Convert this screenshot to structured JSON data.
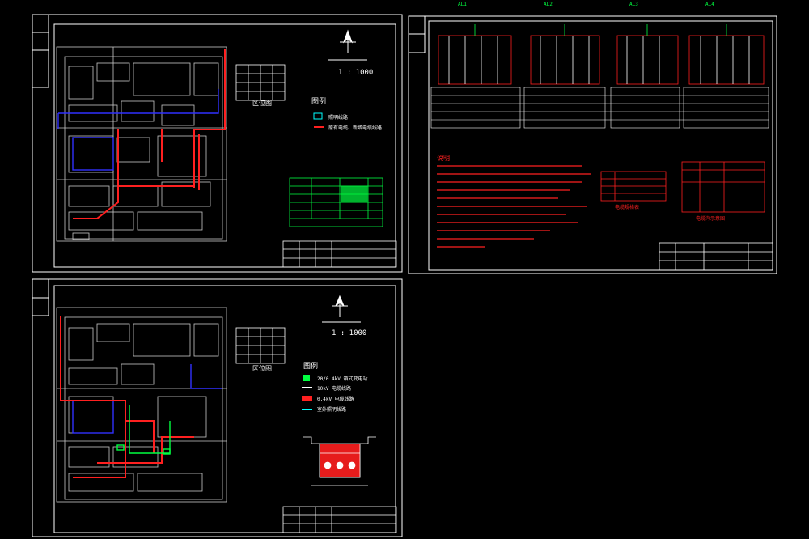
{
  "scale_text": "1 : 1000",
  "scale_text_2": "1 : 1000",
  "sheet_titles": {
    "top_left": "区位图",
    "bottom_left": "区位图",
    "top_right_notes": "说明",
    "cable_table_title": "电缆规格表",
    "conduit_table_title": "电缆沟示意图"
  },
  "legend": {
    "top_title": "图例",
    "top_items": [
      "照明线路",
      "原有电缆、新增电缆线路"
    ],
    "bottom_title": "图例",
    "bottom_items": [
      "20/0.4kV 箱式变电站",
      "10kV 电缆线路",
      "0.4kV 电缆线路",
      "室外照明线路"
    ]
  },
  "panel_labels": [
    "AL1",
    "AL2",
    "AL3",
    "AL4"
  ],
  "colors": {
    "background": "#000000",
    "frame": "#ffffff",
    "red": "#ff2020",
    "blue": "#3030ff",
    "green": "#00ff40",
    "cyan": "#00ffff",
    "yellow": "#ffff00",
    "gray": "#c8c8c8"
  }
}
